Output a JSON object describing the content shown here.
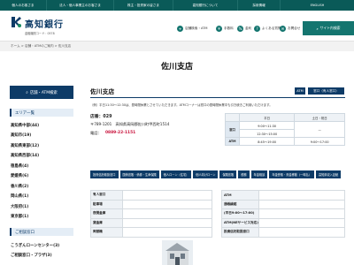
{
  "topnav": [
    "個人のお客さま",
    "法人・個人事業主のお客さま",
    "株主・投資家の皆さま",
    "高知銀行について",
    "採用情報",
    "ENGLISH"
  ],
  "header": {
    "brand": "高知銀行",
    "brand_sub": "金融機関コード：0578",
    "nav": [
      {
        "icon": "⌖",
        "label": "店舗検索・ATM"
      },
      {
        "icon": "¥",
        "label": "手数料"
      },
      {
        "icon": "%",
        "label": "金利"
      },
      {
        "icon": "?",
        "label": "よくある質問"
      },
      {
        "icon": "✉",
        "label": "お問合せ"
      }
    ],
    "site_search": "サイト内検索"
  },
  "breadcrumb": "ホーム > 店舗・ATMのご案内 > 佐川支店",
  "page_title": "佐川支店",
  "sidebar": {
    "search_button": "店舗・ATM検索",
    "area_heading": "エリア一覧",
    "areas": [
      "高知県中部(44)",
      "高知市(19)",
      "高知県東部(12)",
      "高知県西部(14)",
      "徳島県(4)",
      "愛媛県(6)",
      "香川県(2)",
      "岡山県(1)",
      "大阪府(1)",
      "東京都(1)"
    ],
    "other_heading": "ご相談窓口",
    "others": [
      "こうぎんローンセンター(3)",
      "ご相談窓口・プラザ(3)"
    ]
  },
  "main": {
    "branch_name": "佐川支店",
    "tag_atm": "ATM",
    "tag_window": "窓口（有人窓口）",
    "notice": "（例）平日11:30～12:30は、昼時間休業とさせていただきます。ATMコーナーは窓口の昼時間休業中も引き続きご利用いただけます。",
    "store_no": "店番：029",
    "address": "〒789-1201　高知県高岡郡佐川町甲西町1514",
    "phone_label": "電話：",
    "phone": "0889-22-1151"
  },
  "hours": {
    "head": [
      "",
      "平日",
      "土日・祝日"
    ],
    "rows": [
      {
        "label": "窓口",
        "cells": [
          "9:00～11:30",
          "—"
        ]
      },
      {
        "label": "",
        "cells": [
          "12:30～15:00",
          ""
        ]
      },
      {
        "label": "ATM",
        "cells": [
          "8:45～19:00",
          "9:00～17:00"
        ]
      }
    ]
  },
  "services": [
    "投資信託取扱窓口",
    "国債窓販・債券・生命保険",
    "個人ローン（住宅）",
    "個人向けローン",
    "保険窓販",
    "税務",
    "年金相談",
    "年金受取・資金移動（一時払）",
    "高知県収入証紙"
  ],
  "detail_left": {
    "rows": [
      {
        "k": "有人窓口",
        "v": ""
      },
      {
        "k": "駐車場",
        "v": ""
      },
      {
        "k": "夜間金庫",
        "v": ""
      },
      {
        "k": "貸金庫",
        "v": ""
      },
      {
        "k": "両替機",
        "v": ""
      }
    ]
  },
  "detail_right": {
    "rows": [
      {
        "k": "ATM",
        "v": ""
      },
      {
        "k": "通帳繰越",
        "v": ""
      },
      {
        "k": "(平日9:00～17:00)",
        "v": ""
      },
      {
        "k": "ATM(NEサービス対応)",
        "v": ""
      },
      {
        "k": "投資信託取扱窓口",
        "v": ""
      }
    ]
  }
}
